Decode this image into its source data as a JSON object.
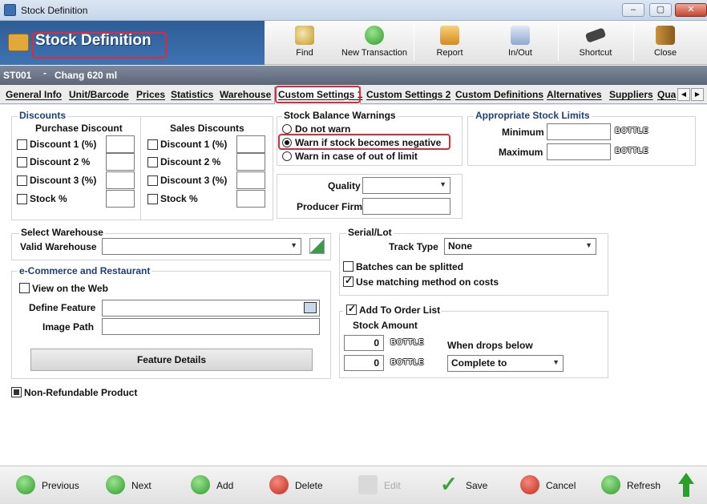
{
  "window": {
    "title": "Stock Definition",
    "minimize_glyph": "–",
    "restore_glyph": "▢",
    "close_glyph": "✕"
  },
  "header": {
    "title": "Stock Definition",
    "icon": "stock-box-icon"
  },
  "toolbar": {
    "find": "Find",
    "new_transaction": "New Transaction",
    "report": "Report",
    "in_out": "In/Out",
    "shortcut": "Shortcut",
    "close": "Close"
  },
  "record": {
    "code": "ST001",
    "separator": "-",
    "name": "Chang 620 ml"
  },
  "tabs": [
    "General Info",
    "Unit/Barcode",
    "Prices",
    "Statistics",
    "Warehouse",
    "Custom Settings 1",
    "Custom Settings 2",
    "Custom Definitions",
    "Alternatives",
    "Suppliers",
    "Qua"
  ],
  "active_tab": "Custom Settings 1",
  "discounts": {
    "title": "Discounts",
    "purchase_header": "Purchase Discount",
    "sales_header": "Sales Discounts",
    "purchase": [
      "Discount 1 (%)",
      "Discount 2 %",
      "Discount 3 (%)",
      "Stock %"
    ],
    "sales": [
      "Discount 1 (%)",
      "Discount 2 %",
      "Discount 3 (%)",
      "Stock %"
    ]
  },
  "balance": {
    "title": "Stock Balance Warnings",
    "options": [
      "Do not warn",
      "Warn if stock becomes negative",
      "Warn in case of out of limit"
    ],
    "selected": "Warn if stock becomes negative"
  },
  "quality": {
    "quality_label": "Quality",
    "quality_value": "",
    "producer_label": "Producer Firm",
    "producer_value": ""
  },
  "limits": {
    "title": "Appropriate Stock Limits",
    "min_label": "Minimum",
    "max_label": "Maximum",
    "unit": "BOTTLE"
  },
  "warehouse": {
    "title": "Select Warehouse",
    "valid_label": "Valid Warehouse",
    "value": ""
  },
  "serial": {
    "title": "Serial/Lot",
    "track_label": "Track Type",
    "track_value": "None",
    "batches_label": "Batches can be splitted",
    "matching_label": "Use matching method on costs"
  },
  "ecommerce": {
    "title": "e-Commerce and Restaurant",
    "view_web": "View on the Web",
    "define_feature": "Define Feature",
    "image_path": "Image Path",
    "feature_details": "Feature Details"
  },
  "order": {
    "add_label": "Add To Order List",
    "stock_amount": "Stock Amount",
    "amount1": "0",
    "amount2": "0",
    "unit": "BOTTLE",
    "drops_label": "When drops below",
    "drops_value": "Complete to"
  },
  "non_refundable": "Non-Refundable Product",
  "footer": {
    "previous": "Previous",
    "next": "Next",
    "add": "Add",
    "delete": "Delete",
    "edit": "Edit",
    "save": "Save",
    "cancel": "Cancel",
    "refresh": "Refresh"
  },
  "colors": {
    "header_blue": "#3e73b3",
    "highlight_red": "#e0293a",
    "group_title": "#1e3f7a"
  }
}
